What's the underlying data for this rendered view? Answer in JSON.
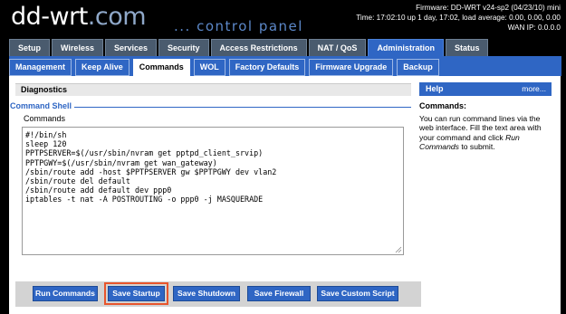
{
  "header": {
    "logo_main": "dd-wrt",
    "logo_suffix": ".com",
    "panel_title": "... control panel",
    "firmware": "Firmware: DD-WRT v24-sp2 (04/23/10) mini",
    "time": "Time: 17:02:10 up 1 day, 17:02, load average: 0.00, 0.00, 0.00",
    "wan_ip": "WAN IP: 0.0.0.0"
  },
  "main_tabs": [
    "Setup",
    "Wireless",
    "Services",
    "Security",
    "Access Restrictions",
    "NAT / QoS",
    "Administration",
    "Status"
  ],
  "main_tabs_active": "Administration",
  "sub_tabs": [
    "Management",
    "Keep Alive",
    "Commands",
    "WOL",
    "Factory Defaults",
    "Firmware Upgrade",
    "Backup"
  ],
  "sub_tabs_active": "Commands",
  "diagnostics": {
    "title": "Diagnostics",
    "legend": "Command Shell",
    "label": "Commands",
    "value": "#!/bin/sh\nsleep 120\nPPTPSERVER=$(/usr/sbin/nvram get pptpd_client_srvip)\nPPTPGWY=$(/usr/sbin/nvram get wan_gateway)\n/sbin/route add -host $PPTPSERVER gw $PPTPGWY dev vlan2\n/sbin/route del default\n/sbin/route add default dev ppp0\niptables -t nat -A POSTROUTING -o ppp0 -j MASQUERADE"
  },
  "buttons": {
    "run": "Run Commands",
    "save_startup": "Save Startup",
    "save_shutdown": "Save Shutdown",
    "save_firewall": "Save Firewall",
    "save_custom": "Save Custom Script"
  },
  "help": {
    "title": "Help",
    "more": "more...",
    "subtitle": "Commands:",
    "text_a": "You can run command lines via the web interface. Fill the text area with your command and click ",
    "text_em": "Run Commands",
    "text_b": " to submit."
  },
  "colors": {
    "accent": "#2f66c4",
    "highlight": "#e8552c",
    "background": "#000000"
  }
}
